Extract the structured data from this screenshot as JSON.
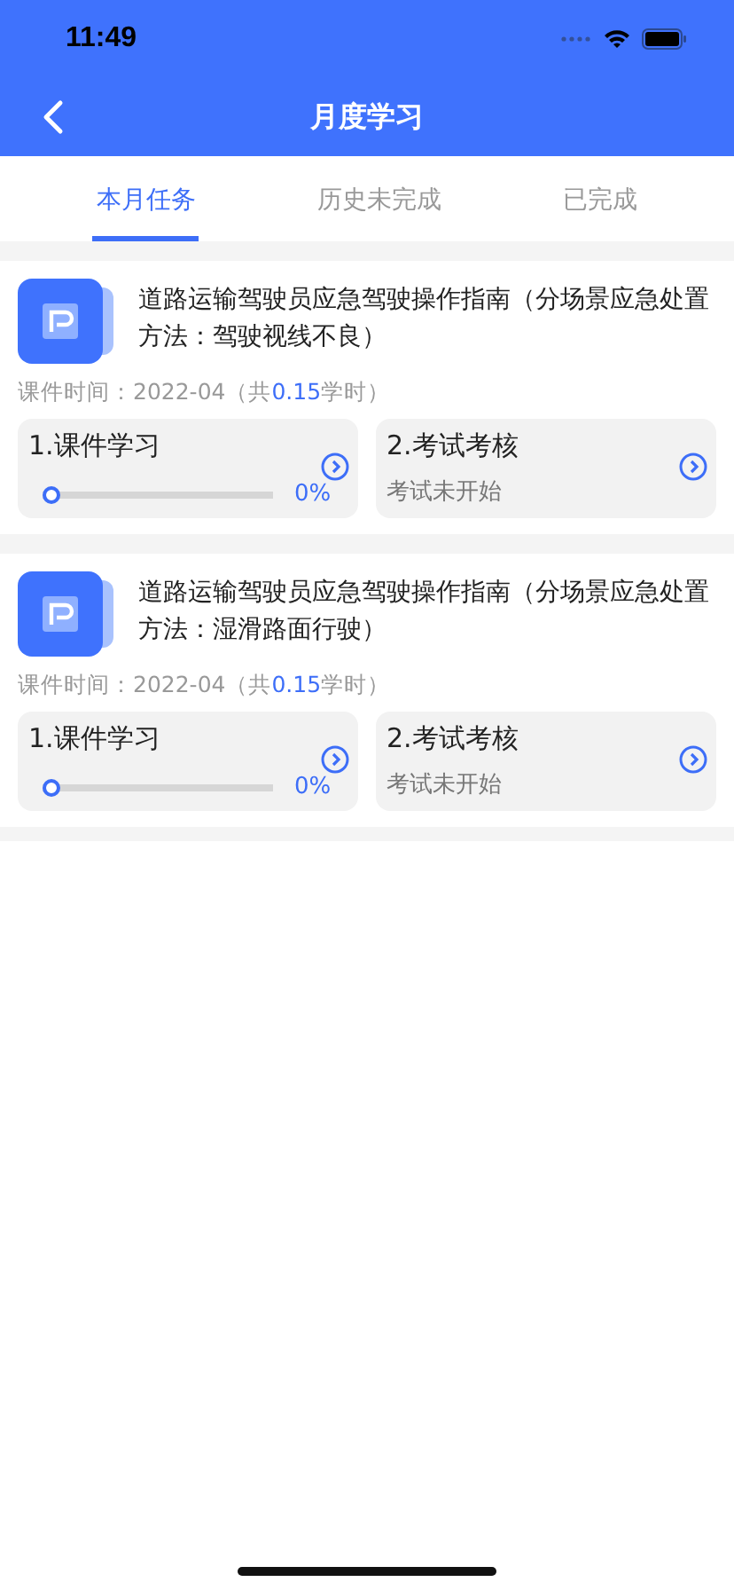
{
  "status_bar": {
    "time": "11:49"
  },
  "nav": {
    "title": "月度学习"
  },
  "tabs": [
    {
      "label": "本月任务",
      "selected": true
    },
    {
      "label": "历史未完成",
      "selected": false
    },
    {
      "label": "已完成",
      "selected": false
    }
  ],
  "courses": [
    {
      "title": "道路运输驾驶员应急驾驶操作指南（分场景应急处置方法：驾驶视线不良）",
      "time_prefix": "课件时间：2022-04（共",
      "hours": "0.15",
      "time_suffix": "学时）",
      "study": {
        "label": "1.课件学习",
        "level": 0,
        "percent": "0%"
      },
      "exam": {
        "label": "2.考试考核",
        "status": "考试未开始"
      }
    },
    {
      "title": "道路运输驾驶员应急驾驶操作指南（分场景应急处置方法：湿滑路面行驶）",
      "time_prefix": "课件时间：2022-04（共",
      "hours": "0.15",
      "time_suffix": "学时）",
      "study": {
        "label": "1.课件学习",
        "level": 0,
        "percent": "0%"
      },
      "exam": {
        "label": "2.考试考核",
        "status": "考试未开始"
      }
    }
  ]
}
